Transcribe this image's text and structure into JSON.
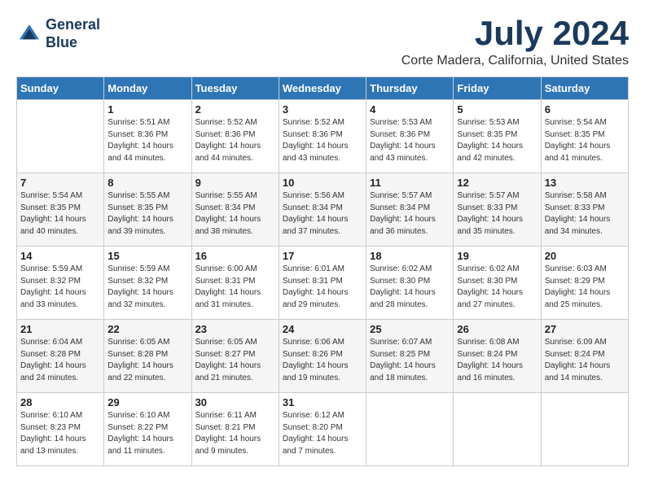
{
  "header": {
    "logo_line1": "General",
    "logo_line2": "Blue",
    "month": "July 2024",
    "location": "Corte Madera, California, United States"
  },
  "days_of_week": [
    "Sunday",
    "Monday",
    "Tuesday",
    "Wednesday",
    "Thursday",
    "Friday",
    "Saturday"
  ],
  "weeks": [
    [
      {
        "day": "",
        "sunrise": "",
        "sunset": "",
        "daylight": ""
      },
      {
        "day": "1",
        "sunrise": "5:51 AM",
        "sunset": "8:36 PM",
        "daylight": "14 hours and 44 minutes."
      },
      {
        "day": "2",
        "sunrise": "5:52 AM",
        "sunset": "8:36 PM",
        "daylight": "14 hours and 44 minutes."
      },
      {
        "day": "3",
        "sunrise": "5:52 AM",
        "sunset": "8:36 PM",
        "daylight": "14 hours and 43 minutes."
      },
      {
        "day": "4",
        "sunrise": "5:53 AM",
        "sunset": "8:36 PM",
        "daylight": "14 hours and 43 minutes."
      },
      {
        "day": "5",
        "sunrise": "5:53 AM",
        "sunset": "8:35 PM",
        "daylight": "14 hours and 42 minutes."
      },
      {
        "day": "6",
        "sunrise": "5:54 AM",
        "sunset": "8:35 PM",
        "daylight": "14 hours and 41 minutes."
      }
    ],
    [
      {
        "day": "7",
        "sunrise": "5:54 AM",
        "sunset": "8:35 PM",
        "daylight": "14 hours and 40 minutes."
      },
      {
        "day": "8",
        "sunrise": "5:55 AM",
        "sunset": "8:35 PM",
        "daylight": "14 hours and 39 minutes."
      },
      {
        "day": "9",
        "sunrise": "5:55 AM",
        "sunset": "8:34 PM",
        "daylight": "14 hours and 38 minutes."
      },
      {
        "day": "10",
        "sunrise": "5:56 AM",
        "sunset": "8:34 PM",
        "daylight": "14 hours and 37 minutes."
      },
      {
        "day": "11",
        "sunrise": "5:57 AM",
        "sunset": "8:34 PM",
        "daylight": "14 hours and 36 minutes."
      },
      {
        "day": "12",
        "sunrise": "5:57 AM",
        "sunset": "8:33 PM",
        "daylight": "14 hours and 35 minutes."
      },
      {
        "day": "13",
        "sunrise": "5:58 AM",
        "sunset": "8:33 PM",
        "daylight": "14 hours and 34 minutes."
      }
    ],
    [
      {
        "day": "14",
        "sunrise": "5:59 AM",
        "sunset": "8:32 PM",
        "daylight": "14 hours and 33 minutes."
      },
      {
        "day": "15",
        "sunrise": "5:59 AM",
        "sunset": "8:32 PM",
        "daylight": "14 hours and 32 minutes."
      },
      {
        "day": "16",
        "sunrise": "6:00 AM",
        "sunset": "8:31 PM",
        "daylight": "14 hours and 31 minutes."
      },
      {
        "day": "17",
        "sunrise": "6:01 AM",
        "sunset": "8:31 PM",
        "daylight": "14 hours and 29 minutes."
      },
      {
        "day": "18",
        "sunrise": "6:02 AM",
        "sunset": "8:30 PM",
        "daylight": "14 hours and 28 minutes."
      },
      {
        "day": "19",
        "sunrise": "6:02 AM",
        "sunset": "8:30 PM",
        "daylight": "14 hours and 27 minutes."
      },
      {
        "day": "20",
        "sunrise": "6:03 AM",
        "sunset": "8:29 PM",
        "daylight": "14 hours and 25 minutes."
      }
    ],
    [
      {
        "day": "21",
        "sunrise": "6:04 AM",
        "sunset": "8:28 PM",
        "daylight": "14 hours and 24 minutes."
      },
      {
        "day": "22",
        "sunrise": "6:05 AM",
        "sunset": "8:28 PM",
        "daylight": "14 hours and 22 minutes."
      },
      {
        "day": "23",
        "sunrise": "6:05 AM",
        "sunset": "8:27 PM",
        "daylight": "14 hours and 21 minutes."
      },
      {
        "day": "24",
        "sunrise": "6:06 AM",
        "sunset": "8:26 PM",
        "daylight": "14 hours and 19 minutes."
      },
      {
        "day": "25",
        "sunrise": "6:07 AM",
        "sunset": "8:25 PM",
        "daylight": "14 hours and 18 minutes."
      },
      {
        "day": "26",
        "sunrise": "6:08 AM",
        "sunset": "8:24 PM",
        "daylight": "14 hours and 16 minutes."
      },
      {
        "day": "27",
        "sunrise": "6:09 AM",
        "sunset": "8:24 PM",
        "daylight": "14 hours and 14 minutes."
      }
    ],
    [
      {
        "day": "28",
        "sunrise": "6:10 AM",
        "sunset": "8:23 PM",
        "daylight": "14 hours and 13 minutes."
      },
      {
        "day": "29",
        "sunrise": "6:10 AM",
        "sunset": "8:22 PM",
        "daylight": "14 hours and 11 minutes."
      },
      {
        "day": "30",
        "sunrise": "6:11 AM",
        "sunset": "8:21 PM",
        "daylight": "14 hours and 9 minutes."
      },
      {
        "day": "31",
        "sunrise": "6:12 AM",
        "sunset": "8:20 PM",
        "daylight": "14 hours and 7 minutes."
      },
      {
        "day": "",
        "sunrise": "",
        "sunset": "",
        "daylight": ""
      },
      {
        "day": "",
        "sunrise": "",
        "sunset": "",
        "daylight": ""
      },
      {
        "day": "",
        "sunrise": "",
        "sunset": "",
        "daylight": ""
      }
    ]
  ]
}
